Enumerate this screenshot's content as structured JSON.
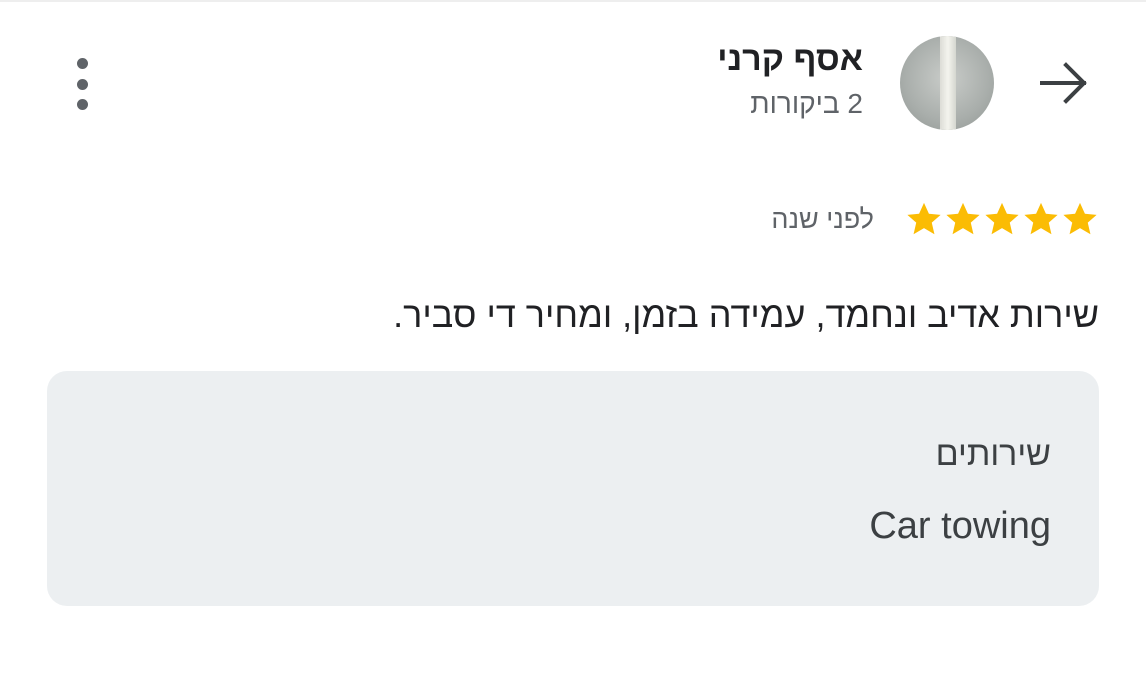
{
  "reviewer": {
    "name": "אסף קרני",
    "review_count": "2 ביקורות",
    "avatar_icon": "profile-photo"
  },
  "actions": {
    "back_icon": "arrow-right-icon",
    "more_icon": "more-vert-icon"
  },
  "review": {
    "rating": 5,
    "rating_max": 5,
    "time_ago": "לפני שנה",
    "text": "שירות אדיב ונחמד, עמידה בזמן, ומחיר די סביר."
  },
  "services": {
    "label": "שירותים",
    "value": "Car towing"
  },
  "colors": {
    "star": "#FBBC04",
    "card_bg": "#ECEFF1",
    "secondary_text": "#5F6368",
    "primary_text": "#202124"
  }
}
